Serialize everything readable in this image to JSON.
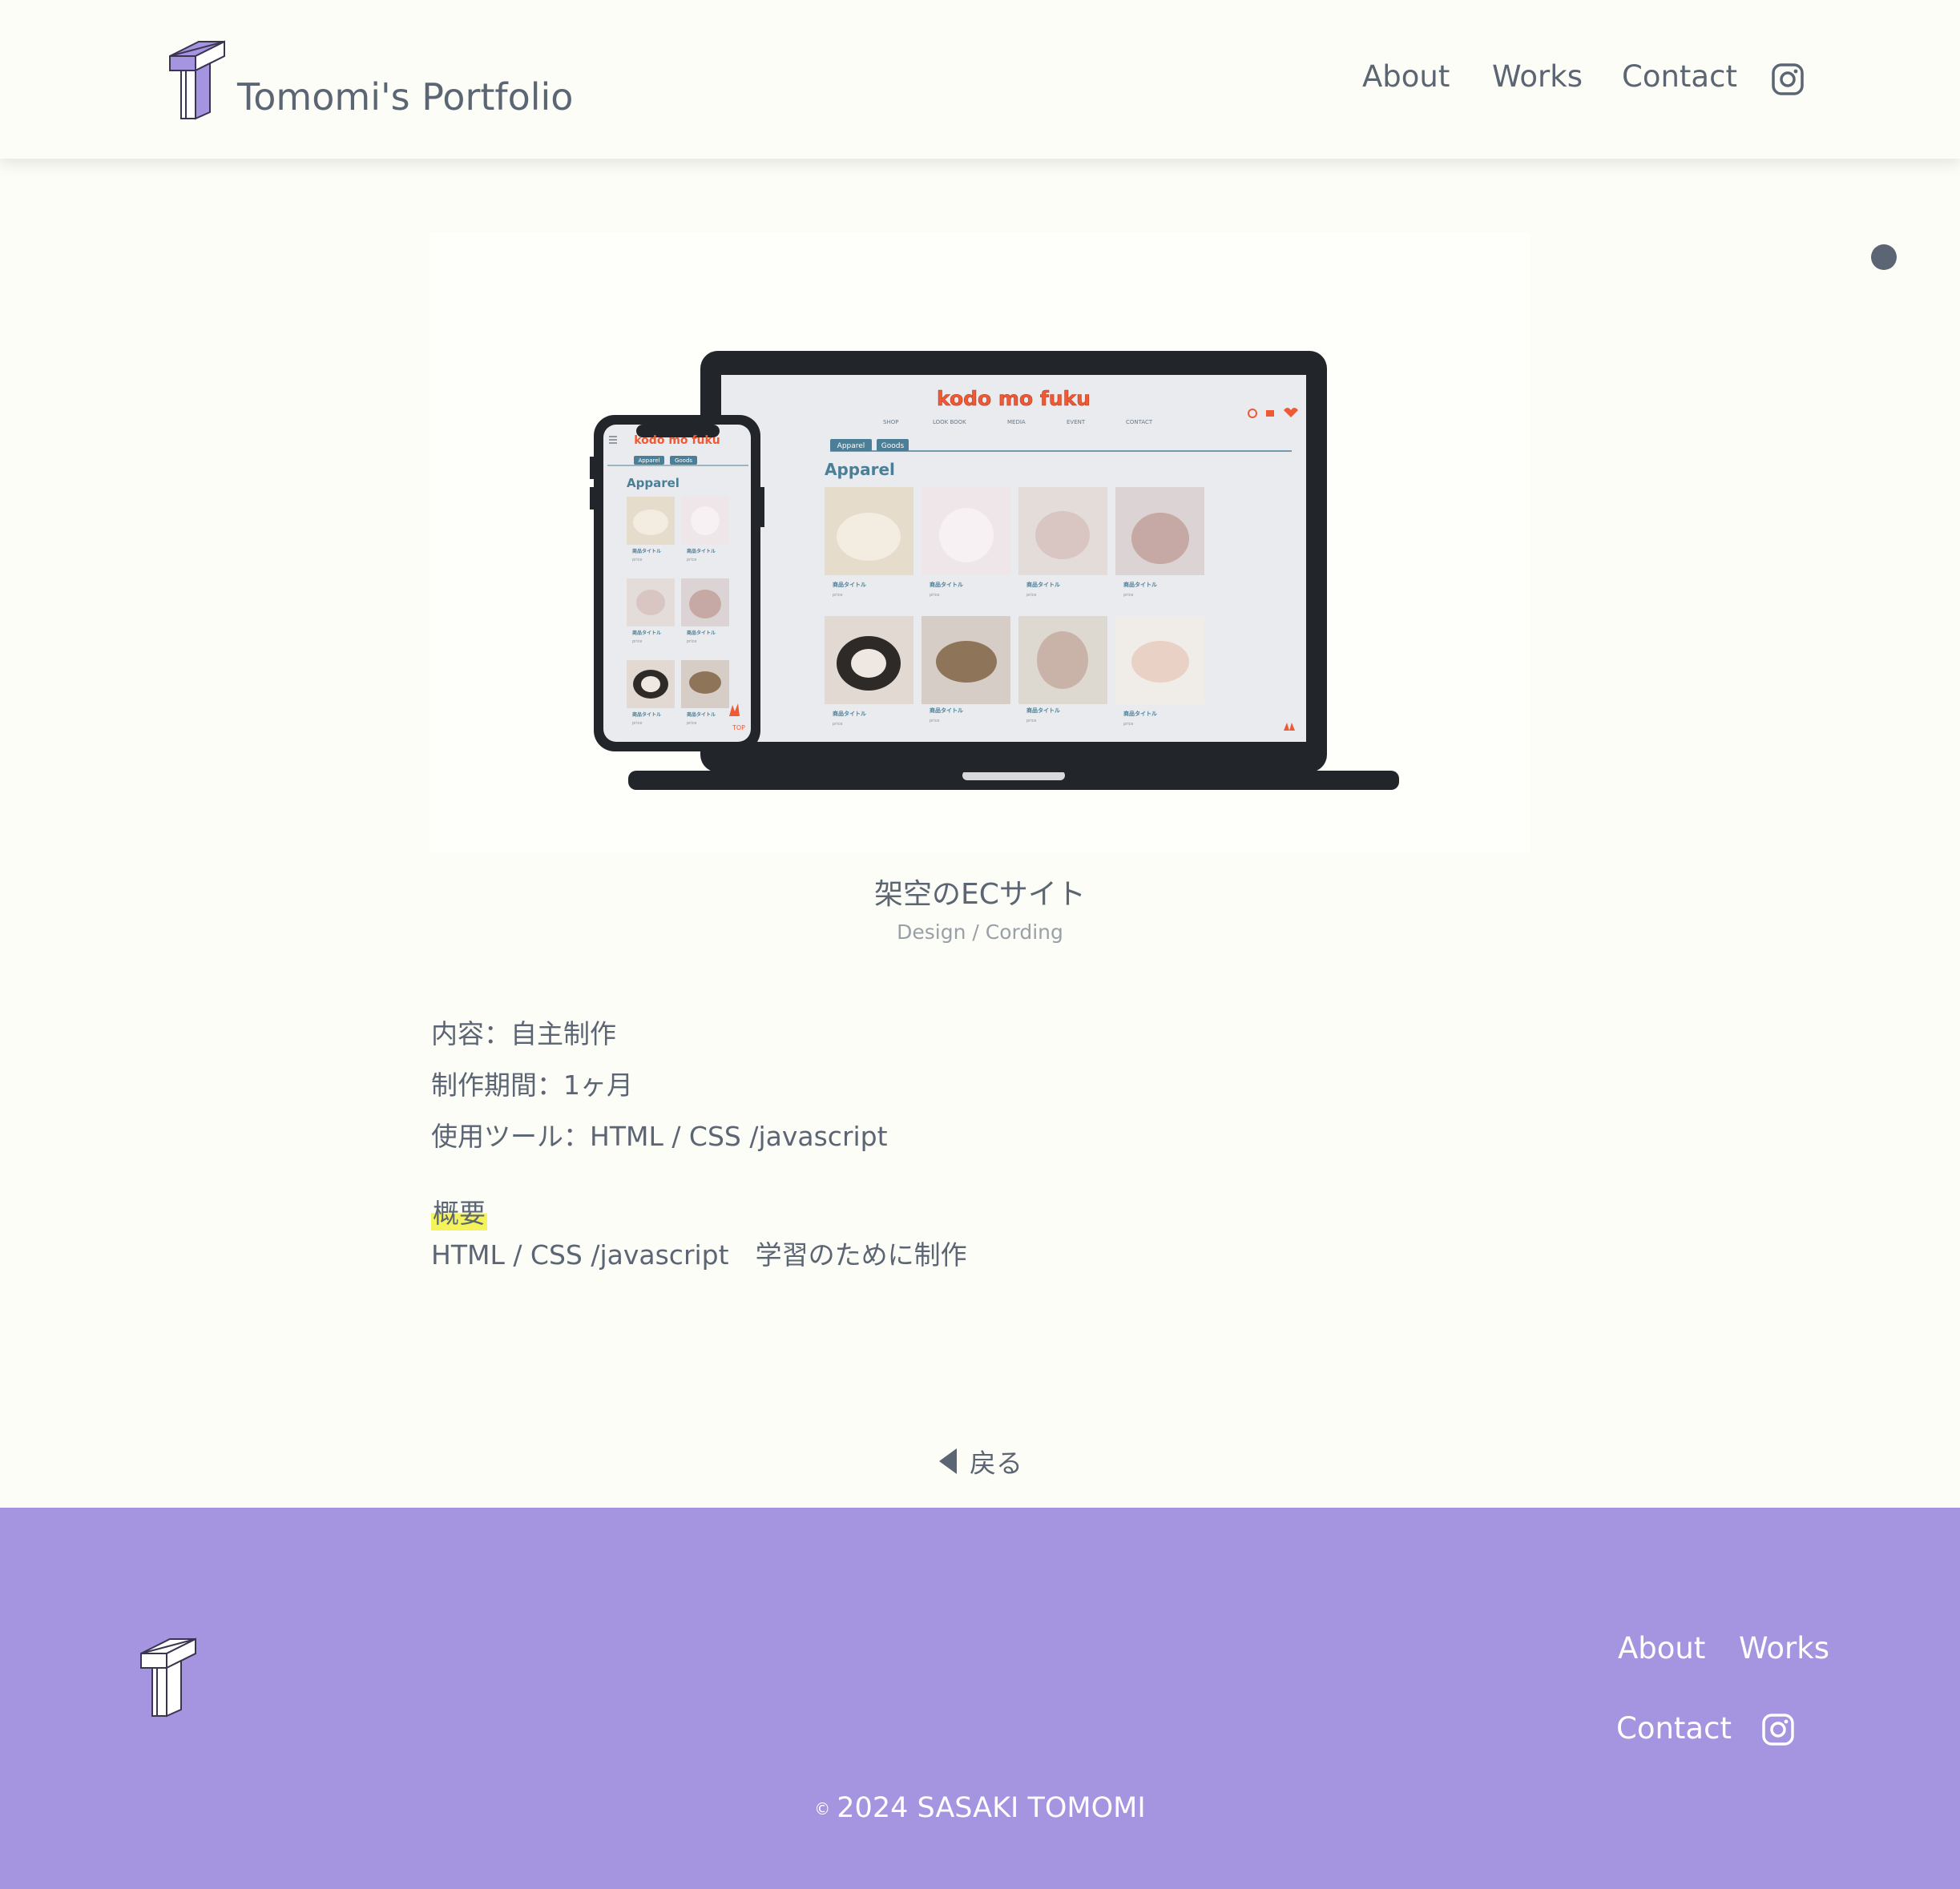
{
  "header": {
    "site_title": "Tomomi's Portfolio",
    "nav": [
      {
        "label": "About"
      },
      {
        "label": "Works"
      },
      {
        "label": "Contact"
      }
    ]
  },
  "work": {
    "mockup": {
      "brand": "kodo mo fuku",
      "nav_items": [
        "SHOP",
        "LOOK BOOK",
        "MEDIA",
        "EVENT",
        "CONTACT"
      ],
      "tabs": [
        "Apparel",
        "Goods"
      ],
      "heading": "Apparel",
      "item_label": "商品タイトル",
      "price_label": "price",
      "top_label": "TOP"
    },
    "title": "架空のECサイト",
    "subtitle": "Design / Cording",
    "details": [
      "内容：自主制作",
      "制作期間：1ヶ月",
      "使用ツール：HTML / CSS /javascript"
    ],
    "overview_label": "概要",
    "overview_text": "HTML / CSS /javascript　学習のために制作"
  },
  "back_label": "戻る",
  "footer": {
    "links": [
      {
        "label": "About"
      },
      {
        "label": "Works"
      },
      {
        "label": "Contact"
      }
    ],
    "copyright_symbol": "©",
    "copyright": "2024 SASAKI TOMOMI"
  },
  "colors": {
    "background": "#fdfdf7",
    "text": "#5b6573",
    "accent_purple": "#a594df",
    "highlight": "#f5f35a",
    "brand_orange": "#ef5a34",
    "mockup_teal": "#4b7f98"
  }
}
